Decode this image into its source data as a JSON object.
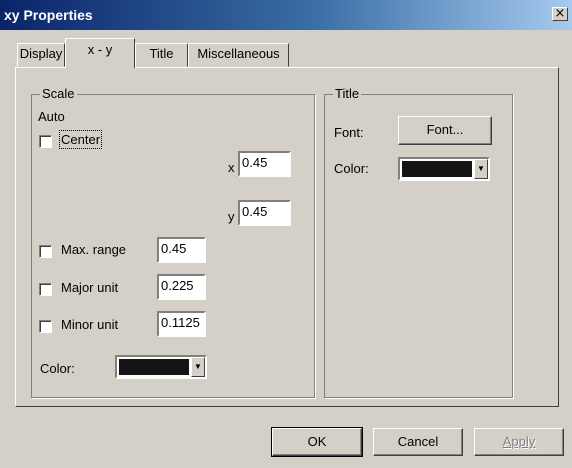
{
  "window": {
    "title": "xy Properties",
    "close_glyph": "×"
  },
  "tabs": [
    {
      "label": "Display",
      "active": false
    },
    {
      "label": "x - y",
      "active": true
    },
    {
      "label": "Title",
      "active": false
    },
    {
      "label": "Miscellaneous",
      "active": false
    }
  ],
  "scale": {
    "caption": "Scale",
    "auto_label": "Auto",
    "center_label": "Center",
    "center_checked": false,
    "x_label": "x",
    "x_value": "0.45",
    "y_label": "y",
    "y_value": "0.45",
    "max_range_label": "Max. range",
    "max_range_checked": false,
    "max_range_value": "0.45",
    "major_unit_label": "Major unit",
    "major_unit_checked": false,
    "major_unit_value": "0.225",
    "minor_unit_label": "Minor unit",
    "minor_unit_checked": false,
    "minor_unit_value": "0.1125",
    "color_label": "Color:",
    "color_value": "#141414"
  },
  "title_group": {
    "caption": "Title",
    "font_label": "Font:",
    "font_button": "Font...",
    "color_label": "Color:",
    "color_value": "#141414"
  },
  "buttons": {
    "ok": "OK",
    "cancel": "Cancel",
    "apply": "Apply"
  },
  "icons": {
    "dropdown": "triangle-down-icon"
  }
}
